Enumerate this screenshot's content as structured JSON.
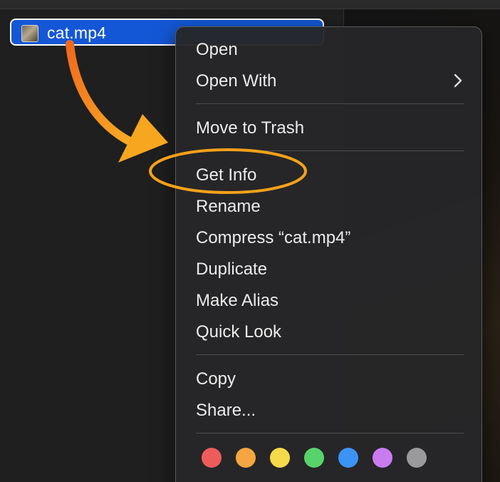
{
  "file": {
    "name": "cat.mp4",
    "thumbnail_icon": "video-thumbnail-icon"
  },
  "menu": {
    "items": [
      {
        "label": "Open"
      },
      {
        "label": "Open With",
        "has_submenu": true,
        "submenu_icon": "chevron-right-icon"
      },
      {
        "label": "Move to Trash"
      },
      {
        "label": "Get Info",
        "highlighted": true
      },
      {
        "label": "Rename"
      },
      {
        "label": "Compress “cat.mp4”"
      },
      {
        "label": "Duplicate"
      },
      {
        "label": "Make Alias"
      },
      {
        "label": "Quick Look"
      },
      {
        "label": "Copy"
      },
      {
        "label": "Share..."
      }
    ],
    "tags": [
      {
        "name": "red",
        "color": "#ee5b5b"
      },
      {
        "name": "orange",
        "color": "#f5a541"
      },
      {
        "name": "yellow",
        "color": "#f7da4a"
      },
      {
        "name": "green",
        "color": "#57d369"
      },
      {
        "name": "blue",
        "color": "#3c93f6"
      },
      {
        "name": "purple",
        "color": "#c97cf0"
      },
      {
        "name": "gray",
        "color": "#9a9a9c"
      }
    ]
  },
  "annotation": {
    "arrow_color": "#f6911e",
    "circle_color": "#f7a11a",
    "arrow_icon": "curved-arrow-icon",
    "highlight_shape": "ellipse-highlight"
  },
  "colors": {
    "selection": "#1457d6",
    "menu_background": "#262628",
    "menu_text": "#ececec"
  }
}
